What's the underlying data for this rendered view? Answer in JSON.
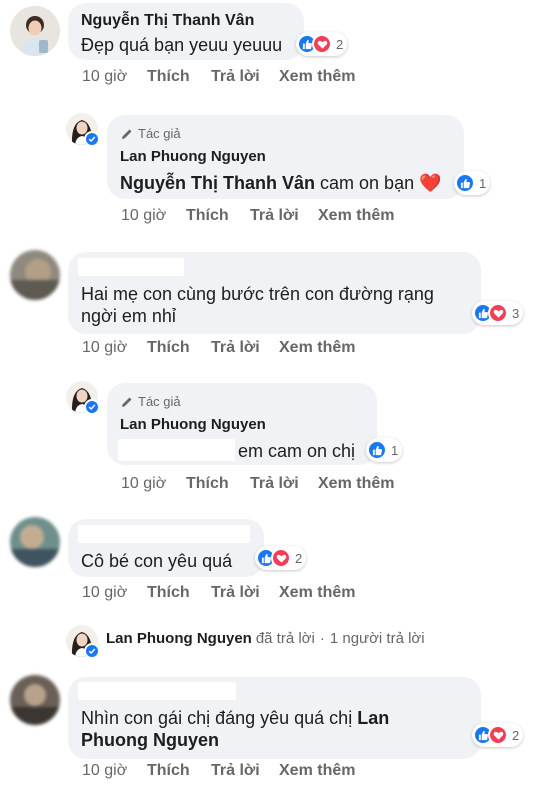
{
  "colors": {
    "bubble": "#f0f2f5",
    "like": "#1877f2",
    "love": "#f33e58",
    "meta": "#65676b"
  },
  "comments": [
    {
      "author": "Nguyễn Thị Thanh Vân",
      "text": "Đẹp quá bạn yeuu yeuuu",
      "time": "10 giờ",
      "like_label": "Thích",
      "reply_label": "Trả lời",
      "more_label": "Xem thêm",
      "reactions": [
        "like-icon",
        "love-icon"
      ],
      "reaction_count": "2"
    },
    {
      "badge": "Tác giả",
      "author": "Lan Phuong Nguyen",
      "mention": "Nguyễn Thị Thanh Vân",
      "text": "cam on bạn",
      "emoji": "❤️",
      "time": "10 giờ",
      "like_label": "Thích",
      "reply_label": "Trả lời",
      "more_label": "Xem thêm",
      "reactions": [
        "like-icon"
      ],
      "reaction_count": "1"
    },
    {
      "text_line1": "Hai mẹ con cùng bước trên con đường rạng",
      "text_line2": "ngời em nhỉ",
      "time": "10 giờ",
      "like_label": "Thích",
      "reply_label": "Trả lời",
      "more_label": "Xem thêm",
      "reactions": [
        "like-icon",
        "love-icon"
      ],
      "reaction_count": "3"
    },
    {
      "badge": "Tác giả",
      "author": "Lan Phuong Nguyen",
      "text": "em cam on chị",
      "time": "10 giờ",
      "like_label": "Thích",
      "reply_label": "Trả lời",
      "more_label": "Xem thêm",
      "reactions": [
        "like-icon"
      ],
      "reaction_count": "1"
    },
    {
      "text": "Cô bé con yêu quá",
      "time": "10 giờ",
      "like_label": "Thích",
      "reply_label": "Trả lời",
      "more_label": "Xem thêm",
      "reactions": [
        "like-icon",
        "love-icon"
      ],
      "reaction_count": "2"
    },
    {
      "text_line1": "Nhìn con gái chị đáng yêu quá chị",
      "mention_line1": "Lan",
      "mention_line2": "Phuong Nguyen",
      "time": "10 giờ",
      "like_label": "Thích",
      "reply_label": "Trả lời",
      "more_label": "Xem thêm",
      "reactions": [
        "like-icon",
        "love-icon"
      ],
      "reaction_count": "2"
    }
  ],
  "reply_summary": {
    "author": "Lan Phuong Nguyen",
    "action": "đã trả lời",
    "separator": "·",
    "count_text": "1 người trả lời"
  }
}
